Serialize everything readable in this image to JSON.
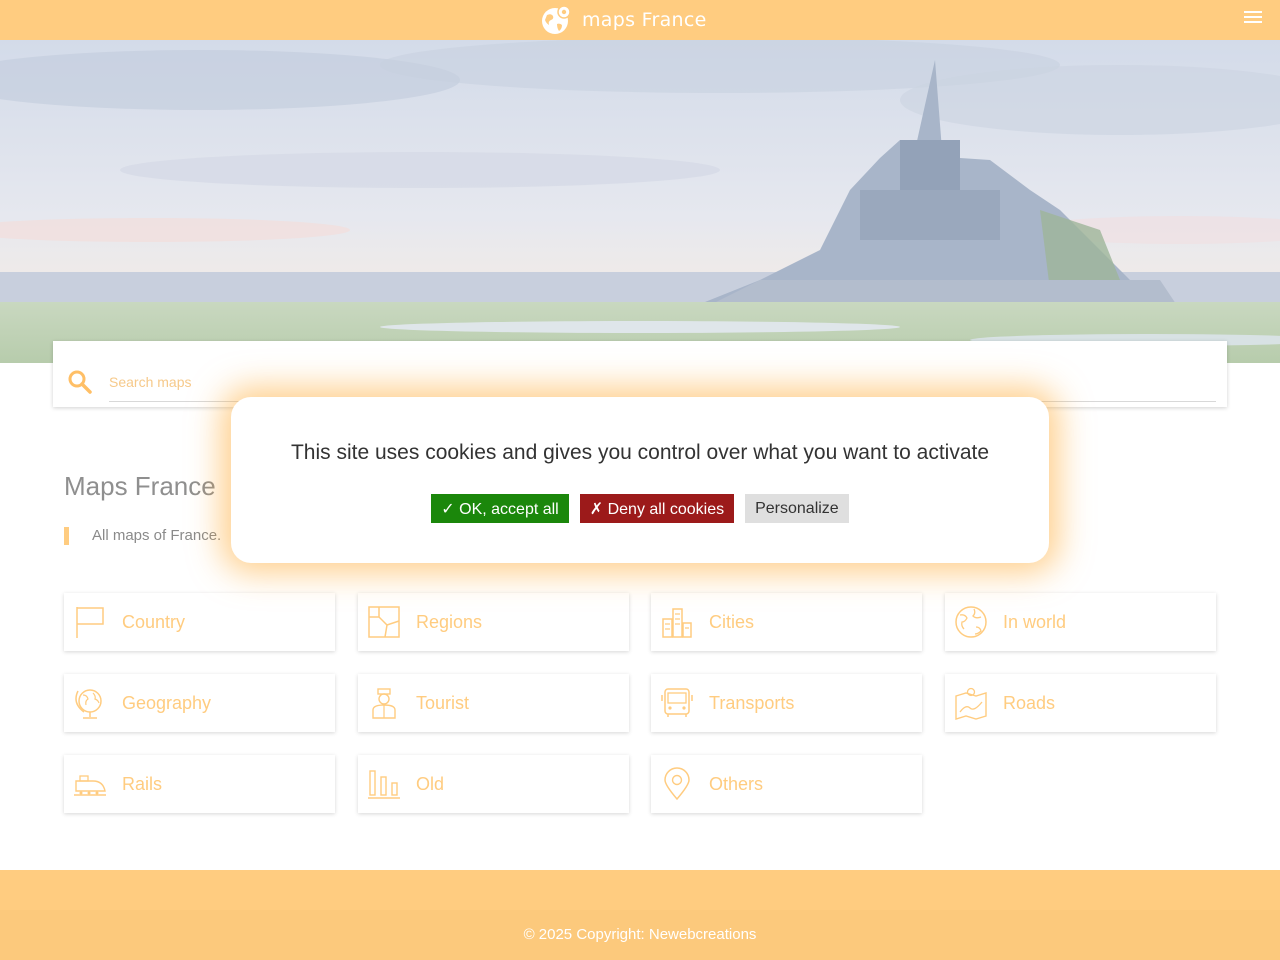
{
  "header": {
    "brand_name": "maps France",
    "logo_icon": "globe-pin-icon",
    "menu_icon": "hamburger-menu-icon",
    "bar_color": "#ffcc80"
  },
  "hero": {
    "image": "mont-saint-michel-landscape"
  },
  "search": {
    "placeholder": "Search maps",
    "icon": "search-icon"
  },
  "main": {
    "title": "Maps France",
    "intro": "All maps of France."
  },
  "categories": [
    {
      "label": "Country",
      "icon": "flag-icon"
    },
    {
      "label": "Regions",
      "icon": "regions-map-icon"
    },
    {
      "label": "Cities",
      "icon": "city-buildings-icon"
    },
    {
      "label": "In world",
      "icon": "world-globe-icon"
    },
    {
      "label": "Geography",
      "icon": "geography-globe-icon"
    },
    {
      "label": "Tourist",
      "icon": "tourist-guide-icon"
    },
    {
      "label": "Transports",
      "icon": "bus-icon"
    },
    {
      "label": "Roads",
      "icon": "road-map-icon"
    },
    {
      "label": "Rails",
      "icon": "train-icon"
    },
    {
      "label": "Old",
      "icon": "ancient-columns-icon"
    },
    {
      "label": "Others",
      "icon": "location-pin-icon"
    }
  ],
  "cookie": {
    "message": "This site uses cookies and gives you control over what you want to activate",
    "accept_label": "✓ OK, accept all",
    "deny_label": "✗ Deny all cookies",
    "personalize_label": "Personalize",
    "accept_color": "#1b870b",
    "deny_color": "#9c1a1a"
  },
  "footer": {
    "copyright_prefix": "© 2025 Copyright: ",
    "copyright_link": "Newebcreations"
  }
}
